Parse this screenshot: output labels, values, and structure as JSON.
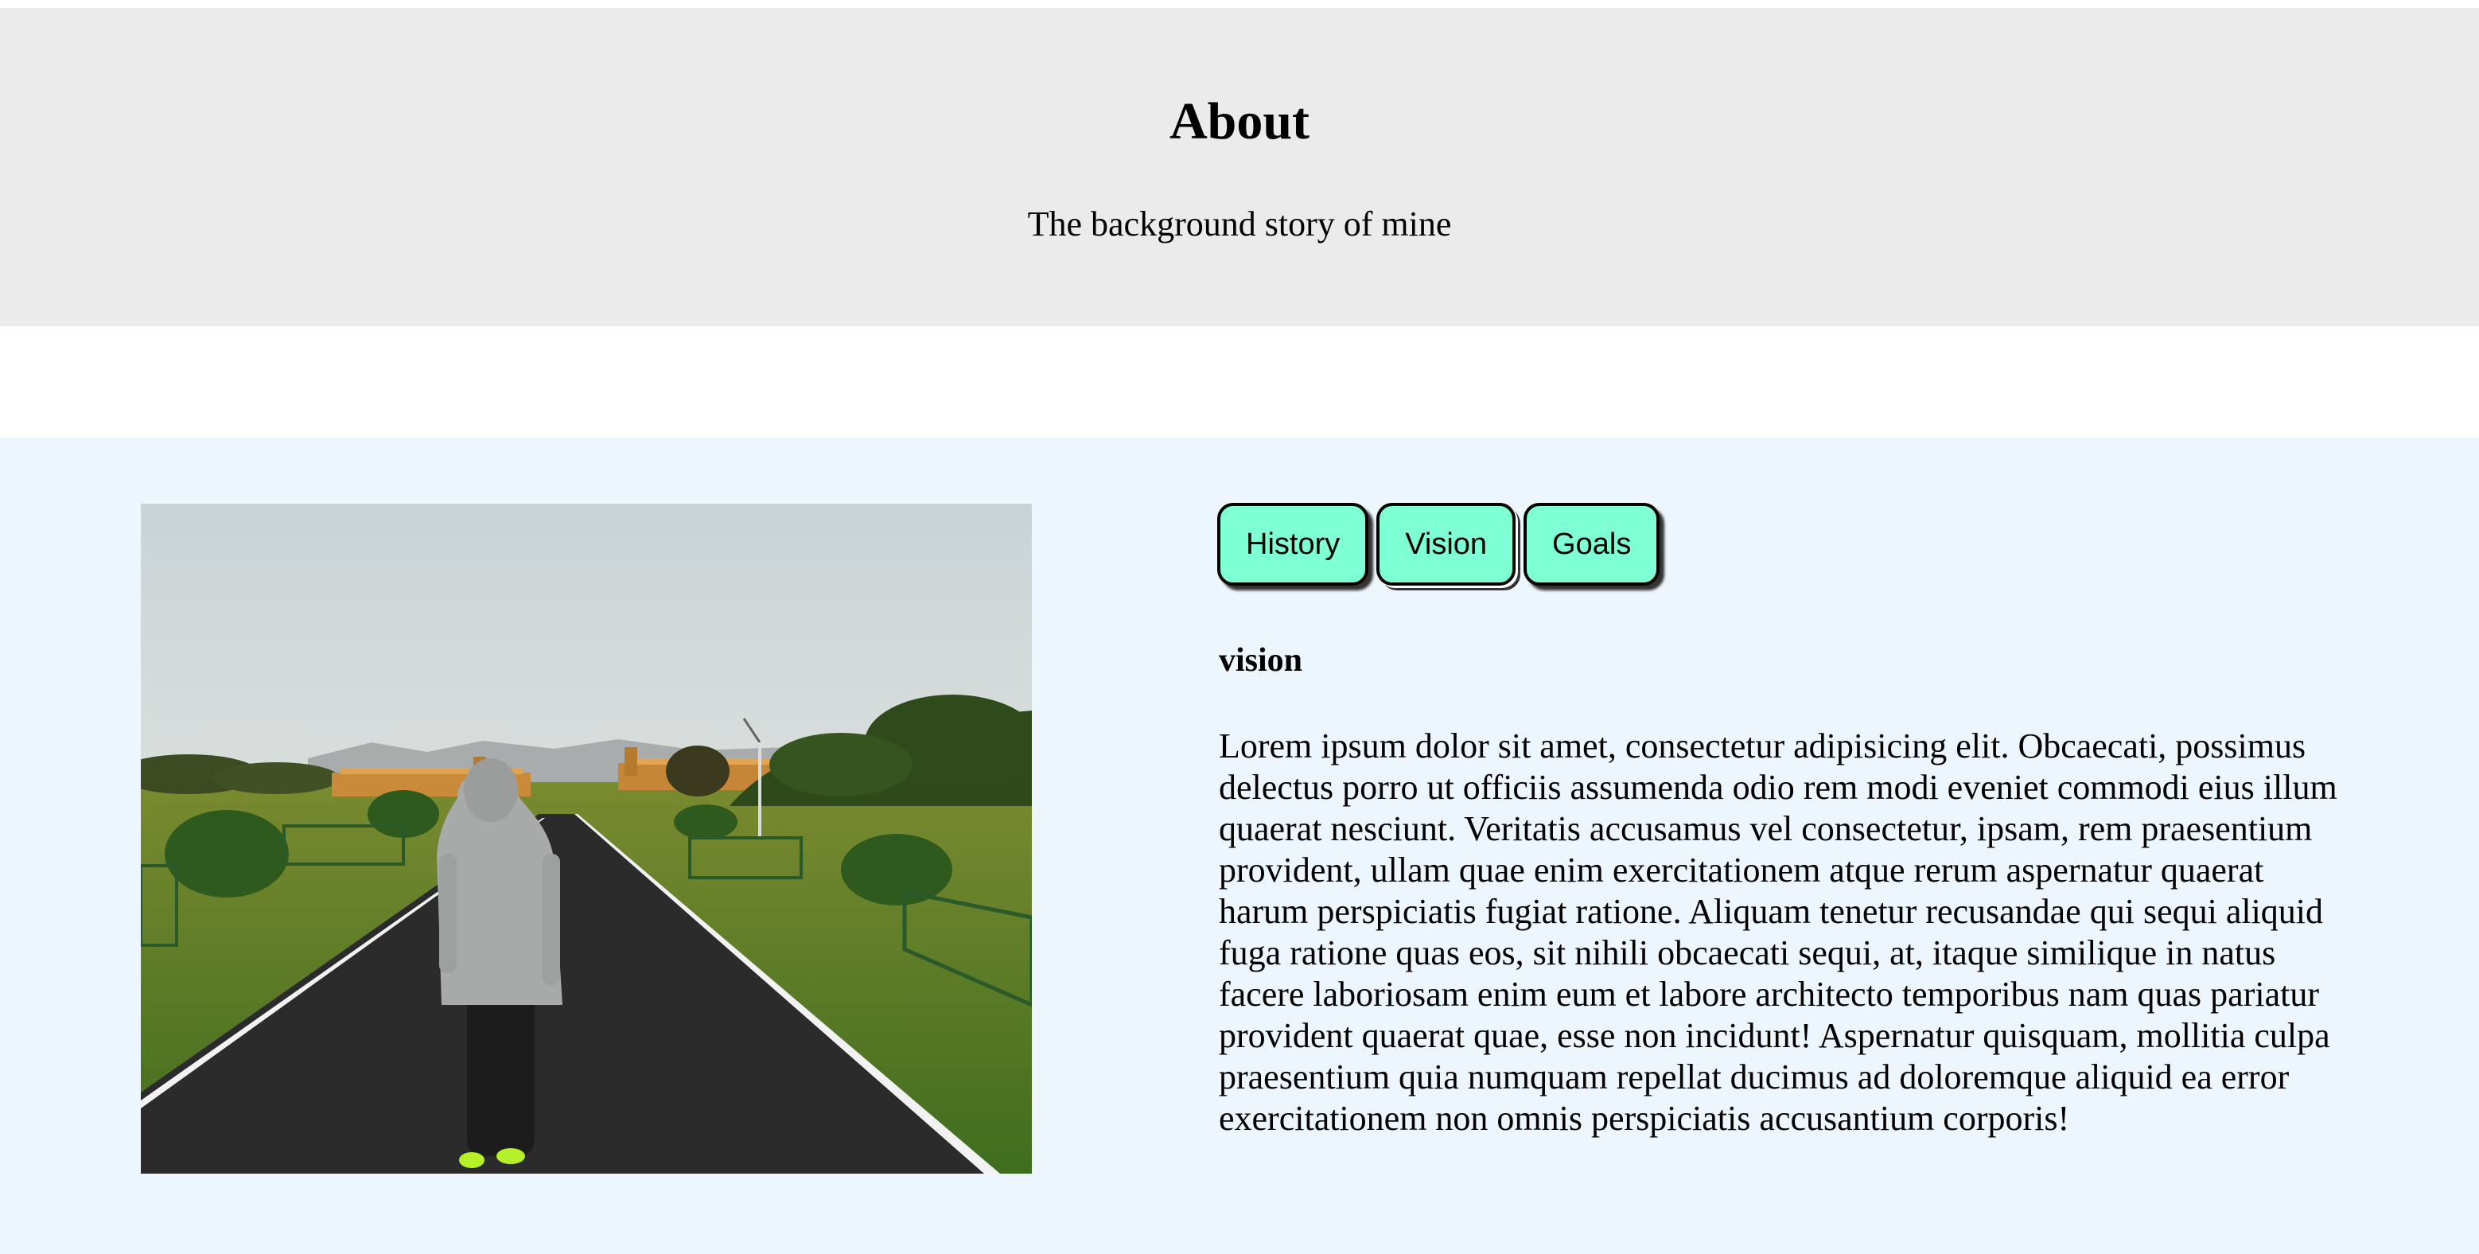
{
  "header": {
    "title": "About",
    "subtitle": "The background story of mine"
  },
  "about": {
    "tabs": [
      {
        "label": "History"
      },
      {
        "label": "Vision"
      },
      {
        "label": "Goals"
      }
    ],
    "active_tab": "Vision",
    "content": {
      "heading": "vision",
      "body": "Lorem ipsum dolor sit amet, consectetur adipisicing elit. Obcaecati, possimus delectus porro ut officiis assumenda odio rem modi eveniet commodi eius illum quaerat nesciunt. Veritatis accusamus vel consectetur, ipsam, rem praesentium provident, ullam quae enim exercitationem atque rerum aspernatur quaerat harum perspiciatis fugiat ratione. Aliquam tenetur recusandae qui sequi aliquid fuga ratione quas eos, sit nihili obcaecati sequi, at, itaque similique in natus facere laboriosam enim eum et labore architecto temporibus nam quas pariatur provident quaerat quae, esse non incidunt! Aspernatur quisquam, mollitia culpa praesentium quia numquam repellat ducimus ad doloremque aliquid ea error exercitationem non omnis perspiciatis accusantium corporis!"
    }
  },
  "colors": {
    "hero_background": "#ebebeb",
    "section_background": "#eef6fd",
    "tab_background": "#7fffd4"
  }
}
